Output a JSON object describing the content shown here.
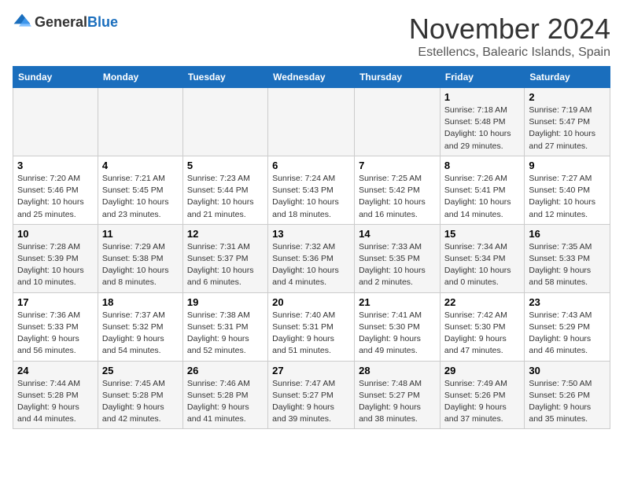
{
  "logo": {
    "general": "General",
    "blue": "Blue"
  },
  "title": "November 2024",
  "location": "Estellencs, Balearic Islands, Spain",
  "weekdays": [
    "Sunday",
    "Monday",
    "Tuesday",
    "Wednesday",
    "Thursday",
    "Friday",
    "Saturday"
  ],
  "weeks": [
    [
      {
        "day": "",
        "info": ""
      },
      {
        "day": "",
        "info": ""
      },
      {
        "day": "",
        "info": ""
      },
      {
        "day": "",
        "info": ""
      },
      {
        "day": "",
        "info": ""
      },
      {
        "day": "1",
        "info": "Sunrise: 7:18 AM\nSunset: 5:48 PM\nDaylight: 10 hours and 29 minutes."
      },
      {
        "day": "2",
        "info": "Sunrise: 7:19 AM\nSunset: 5:47 PM\nDaylight: 10 hours and 27 minutes."
      }
    ],
    [
      {
        "day": "3",
        "info": "Sunrise: 7:20 AM\nSunset: 5:46 PM\nDaylight: 10 hours and 25 minutes."
      },
      {
        "day": "4",
        "info": "Sunrise: 7:21 AM\nSunset: 5:45 PM\nDaylight: 10 hours and 23 minutes."
      },
      {
        "day": "5",
        "info": "Sunrise: 7:23 AM\nSunset: 5:44 PM\nDaylight: 10 hours and 21 minutes."
      },
      {
        "day": "6",
        "info": "Sunrise: 7:24 AM\nSunset: 5:43 PM\nDaylight: 10 hours and 18 minutes."
      },
      {
        "day": "7",
        "info": "Sunrise: 7:25 AM\nSunset: 5:42 PM\nDaylight: 10 hours and 16 minutes."
      },
      {
        "day": "8",
        "info": "Sunrise: 7:26 AM\nSunset: 5:41 PM\nDaylight: 10 hours and 14 minutes."
      },
      {
        "day": "9",
        "info": "Sunrise: 7:27 AM\nSunset: 5:40 PM\nDaylight: 10 hours and 12 minutes."
      }
    ],
    [
      {
        "day": "10",
        "info": "Sunrise: 7:28 AM\nSunset: 5:39 PM\nDaylight: 10 hours and 10 minutes."
      },
      {
        "day": "11",
        "info": "Sunrise: 7:29 AM\nSunset: 5:38 PM\nDaylight: 10 hours and 8 minutes."
      },
      {
        "day": "12",
        "info": "Sunrise: 7:31 AM\nSunset: 5:37 PM\nDaylight: 10 hours and 6 minutes."
      },
      {
        "day": "13",
        "info": "Sunrise: 7:32 AM\nSunset: 5:36 PM\nDaylight: 10 hours and 4 minutes."
      },
      {
        "day": "14",
        "info": "Sunrise: 7:33 AM\nSunset: 5:35 PM\nDaylight: 10 hours and 2 minutes."
      },
      {
        "day": "15",
        "info": "Sunrise: 7:34 AM\nSunset: 5:34 PM\nDaylight: 10 hours and 0 minutes."
      },
      {
        "day": "16",
        "info": "Sunrise: 7:35 AM\nSunset: 5:33 PM\nDaylight: 9 hours and 58 minutes."
      }
    ],
    [
      {
        "day": "17",
        "info": "Sunrise: 7:36 AM\nSunset: 5:33 PM\nDaylight: 9 hours and 56 minutes."
      },
      {
        "day": "18",
        "info": "Sunrise: 7:37 AM\nSunset: 5:32 PM\nDaylight: 9 hours and 54 minutes."
      },
      {
        "day": "19",
        "info": "Sunrise: 7:38 AM\nSunset: 5:31 PM\nDaylight: 9 hours and 52 minutes."
      },
      {
        "day": "20",
        "info": "Sunrise: 7:40 AM\nSunset: 5:31 PM\nDaylight: 9 hours and 51 minutes."
      },
      {
        "day": "21",
        "info": "Sunrise: 7:41 AM\nSunset: 5:30 PM\nDaylight: 9 hours and 49 minutes."
      },
      {
        "day": "22",
        "info": "Sunrise: 7:42 AM\nSunset: 5:30 PM\nDaylight: 9 hours and 47 minutes."
      },
      {
        "day": "23",
        "info": "Sunrise: 7:43 AM\nSunset: 5:29 PM\nDaylight: 9 hours and 46 minutes."
      }
    ],
    [
      {
        "day": "24",
        "info": "Sunrise: 7:44 AM\nSunset: 5:28 PM\nDaylight: 9 hours and 44 minutes."
      },
      {
        "day": "25",
        "info": "Sunrise: 7:45 AM\nSunset: 5:28 PM\nDaylight: 9 hours and 42 minutes."
      },
      {
        "day": "26",
        "info": "Sunrise: 7:46 AM\nSunset: 5:28 PM\nDaylight: 9 hours and 41 minutes."
      },
      {
        "day": "27",
        "info": "Sunrise: 7:47 AM\nSunset: 5:27 PM\nDaylight: 9 hours and 39 minutes."
      },
      {
        "day": "28",
        "info": "Sunrise: 7:48 AM\nSunset: 5:27 PM\nDaylight: 9 hours and 38 minutes."
      },
      {
        "day": "29",
        "info": "Sunrise: 7:49 AM\nSunset: 5:26 PM\nDaylight: 9 hours and 37 minutes."
      },
      {
        "day": "30",
        "info": "Sunrise: 7:50 AM\nSunset: 5:26 PM\nDaylight: 9 hours and 35 minutes."
      }
    ]
  ]
}
